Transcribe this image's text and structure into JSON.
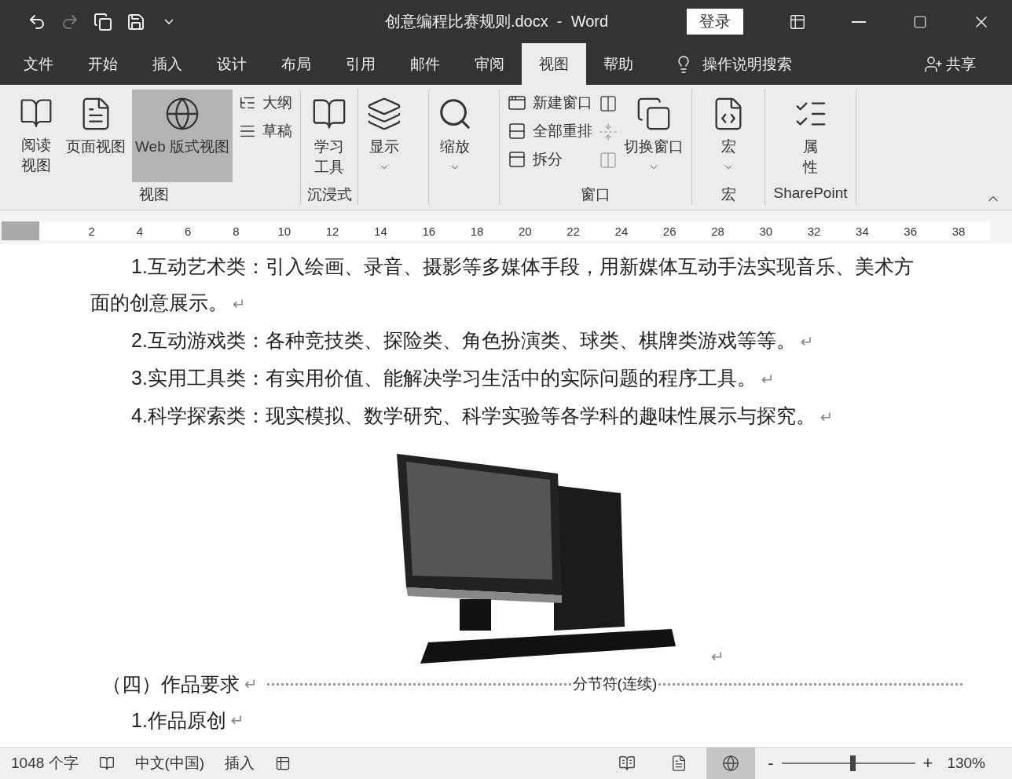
{
  "window": {
    "title": "创意编程比赛规则.docx  -  Word",
    "login": "登录"
  },
  "menu_tabs": [
    {
      "label": "文件",
      "selected": false
    },
    {
      "label": "开始",
      "selected": false
    },
    {
      "label": "插入",
      "selected": false
    },
    {
      "label": "设计",
      "selected": false
    },
    {
      "label": "布局",
      "selected": false
    },
    {
      "label": "引用",
      "selected": false
    },
    {
      "label": "邮件",
      "selected": false
    },
    {
      "label": "审阅",
      "selected": false
    },
    {
      "label": "视图",
      "selected": true
    },
    {
      "label": "帮助",
      "selected": false
    }
  ],
  "tell_me": "操作说明搜索",
  "share": "共享",
  "ribbon": {
    "views": {
      "label": "视图",
      "buttons": [
        {
          "label": "阅读视图",
          "selected": false
        },
        {
          "label": "页面视图",
          "selected": false
        },
        {
          "label": "Web 版式视图",
          "selected": true
        }
      ],
      "small": [
        "大纲",
        "草稿"
      ]
    },
    "immersive": {
      "label": "沉浸式",
      "button": "学习工具"
    },
    "show": {
      "button": "显示"
    },
    "zoom": {
      "button": "缩放"
    },
    "window": {
      "label": "窗口",
      "small": [
        "新建窗口",
        "全部重排",
        "拆分"
      ],
      "switch": "切换窗口"
    },
    "macros": {
      "label": "宏",
      "button": "宏"
    },
    "sharepoint": {
      "label": "SharePoint",
      "button": "属性"
    }
  },
  "ruler": {
    "numbers": [
      "2",
      "4",
      "6",
      "8",
      "10",
      "12",
      "14",
      "16",
      "18",
      "20",
      "22",
      "24",
      "26",
      "28",
      "30",
      "32",
      "34",
      "36",
      "38"
    ]
  },
  "document": {
    "paragraphs": [
      {
        "text": "1.互动艺术类：引入绘画、录音、摄影等多媒体手段，用新媒体互动手法实现音乐、美术方面的创意展示。",
        "mark": "↵"
      },
      {
        "text": "2.互动游戏类：各种竞技类、探险类、角色扮演类、球类、棋牌类游戏等等。",
        "mark": "↵"
      },
      {
        "text": "3.实用工具类：有实用价值、能解决学习生活中的实际问题的程序工具。",
        "mark": "↵"
      },
      {
        "text": "4.科学探索类：现实模拟、数学研究、科学实验等各学科的趣味性展示与探究。",
        "mark": "↵"
      }
    ],
    "picture_mark": "↵",
    "heading": {
      "text": "（四）作品要求",
      "mark": "↵",
      "section_break": "分节符(连续)"
    },
    "item": {
      "text": "1.作品原创",
      "mark": "↵"
    }
  },
  "status_bar": {
    "word_count": "1048 个字",
    "language": "中文(中国)",
    "mode": "插入",
    "views": [
      {
        "kind": "read",
        "selected": false
      },
      {
        "kind": "print",
        "selected": false
      },
      {
        "kind": "web",
        "selected": true
      }
    ],
    "zoom": {
      "minus": "-",
      "plus": "+",
      "level": 0.53,
      "reading": "130%"
    }
  }
}
